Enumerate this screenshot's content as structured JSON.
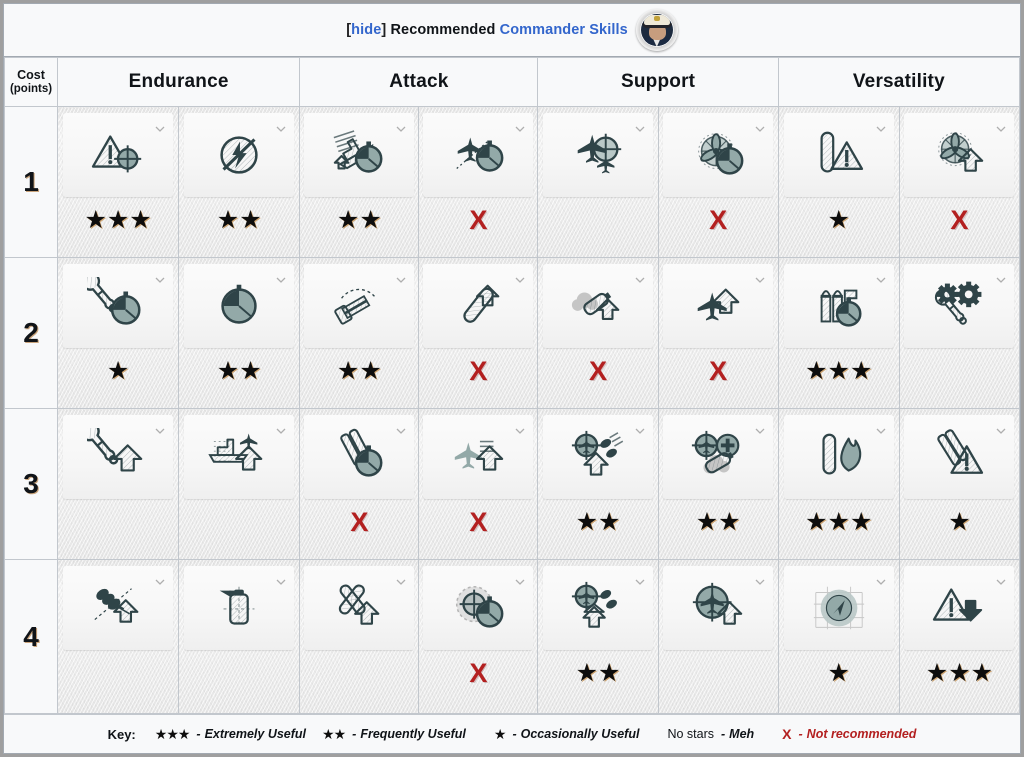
{
  "header": {
    "hide_label": "hide",
    "bracket_open": "[",
    "bracket_close": "]",
    "recommended_label": "Recommended",
    "commander_skills_label": "Commander Skills",
    "portrait_name": "commander-portrait"
  },
  "table": {
    "cost_header_line1": "Cost",
    "cost_header_line2": "(points)",
    "categories": [
      "Endurance",
      "Attack",
      "Support",
      "Versatility"
    ],
    "rows": [
      {
        "cost": "1",
        "cells": [
          {
            "category": "Endurance",
            "icon": "warning-triangle-target",
            "rating": "3",
            "rating_text": "★★★"
          },
          {
            "category": "Endurance",
            "icon": "no-fire-circle",
            "rating": "2",
            "rating_text": "★★"
          },
          {
            "category": "Attack",
            "icon": "ship-speed-stopwatch",
            "rating": "2",
            "rating_text": "★★"
          },
          {
            "category": "Attack",
            "icon": "plane-stopwatch",
            "rating": "x",
            "rating_text": "X"
          },
          {
            "category": "Support",
            "icon": "plane-squadron-target",
            "rating": "none",
            "rating_text": ""
          },
          {
            "category": "Support",
            "icon": "propeller-stopwatch",
            "rating": "x",
            "rating_text": "X"
          },
          {
            "category": "Versatility",
            "icon": "torpedo-warning",
            "rating": "1",
            "rating_text": "★"
          },
          {
            "category": "Versatility",
            "icon": "propeller-arrow-up",
            "rating": "x",
            "rating_text": "X"
          }
        ]
      },
      {
        "cost": "2",
        "cells": [
          {
            "category": "Endurance",
            "icon": "wrench-stopwatch",
            "rating": "1",
            "rating_text": "★"
          },
          {
            "category": "Endurance",
            "icon": "stopwatch",
            "rating": "2",
            "rating_text": "★★"
          },
          {
            "category": "Attack",
            "icon": "aa-guns-arc",
            "rating": "2",
            "rating_text": "★★"
          },
          {
            "category": "Attack",
            "icon": "torpedo-arrow-up",
            "rating": "x",
            "rating_text": "X"
          },
          {
            "category": "Support",
            "icon": "smoke-bomb-arrow-up",
            "rating": "x",
            "rating_text": "X"
          },
          {
            "category": "Support",
            "icon": "plane-arrow-up",
            "rating": "x",
            "rating_text": "X"
          },
          {
            "category": "Versatility",
            "icon": "shells-stopwatch",
            "rating": "3",
            "rating_text": "★★★"
          },
          {
            "category": "Versatility",
            "icon": "gears-wrench",
            "rating": "none",
            "rating_text": ""
          }
        ]
      },
      {
        "cost": "3",
        "cells": [
          {
            "category": "Endurance",
            "icon": "wrench-arrow-up",
            "rating": "none",
            "rating_text": ""
          },
          {
            "category": "Endurance",
            "icon": "carrier-plane-arrow-up",
            "rating": "none",
            "rating_text": ""
          },
          {
            "category": "Attack",
            "icon": "main-guns-stopwatch",
            "rating": "x",
            "rating_text": "X"
          },
          {
            "category": "Attack",
            "icon": "plane-arrow-up-boost",
            "rating": "x",
            "rating_text": "X"
          },
          {
            "category": "Support",
            "icon": "aa-target-flak-arrow-up",
            "rating": "2",
            "rating_text": "★★"
          },
          {
            "category": "Support",
            "icon": "aa-target-plus-bomb",
            "rating": "2",
            "rating_text": "★★"
          },
          {
            "category": "Versatility",
            "icon": "torpedo-fire",
            "rating": "3",
            "rating_text": "★★★"
          },
          {
            "category": "Versatility",
            "icon": "guns-warning",
            "rating": "1",
            "rating_text": "★"
          }
        ]
      },
      {
        "cost": "4",
        "cells": [
          {
            "category": "Endurance",
            "icon": "shells-burst-arrow-up",
            "rating": "none",
            "rating_text": ""
          },
          {
            "category": "Endurance",
            "icon": "smoke-generator",
            "rating": "none",
            "rating_text": ""
          },
          {
            "category": "Attack",
            "icon": "crossed-torpedoes-arrow-up",
            "rating": "none",
            "rating_text": ""
          },
          {
            "category": "Attack",
            "icon": "radar-stopwatch",
            "rating": "x",
            "rating_text": "X"
          },
          {
            "category": "Support",
            "icon": "aa-flak-double-arrow-up",
            "rating": "2",
            "rating_text": "★★"
          },
          {
            "category": "Support",
            "icon": "fighter-target-arrow-up",
            "rating": "none",
            "rating_text": ""
          },
          {
            "category": "Versatility",
            "icon": "radar-sonar-sweep",
            "rating": "1",
            "rating_text": "★"
          },
          {
            "category": "Versatility",
            "icon": "warning-arrow-down",
            "rating": "3",
            "rating_text": "★★★"
          }
        ]
      }
    ]
  },
  "key": {
    "label": "Key:",
    "items": [
      {
        "symbol": "★★★",
        "dash": "-",
        "text": "Extremely Useful",
        "type": "stars"
      },
      {
        "symbol": "★★",
        "dash": "-",
        "text": "Frequently Useful",
        "type": "stars"
      },
      {
        "symbol": "★",
        "dash": "-",
        "text": "Occasionally Useful",
        "type": "stars"
      },
      {
        "symbol": "No stars",
        "dash": "-",
        "text": "Meh",
        "type": "plain"
      },
      {
        "symbol": "X",
        "dash": "-",
        "text": "Not recommended",
        "type": "x"
      }
    ]
  },
  "colors": {
    "link": "#3366cc",
    "x_red": "#b32020",
    "icon_dark": "#2c3e42",
    "icon_fill": "#8fa6a6",
    "page_bg": "#f8f9fa",
    "border": "#c2c7cd"
  }
}
